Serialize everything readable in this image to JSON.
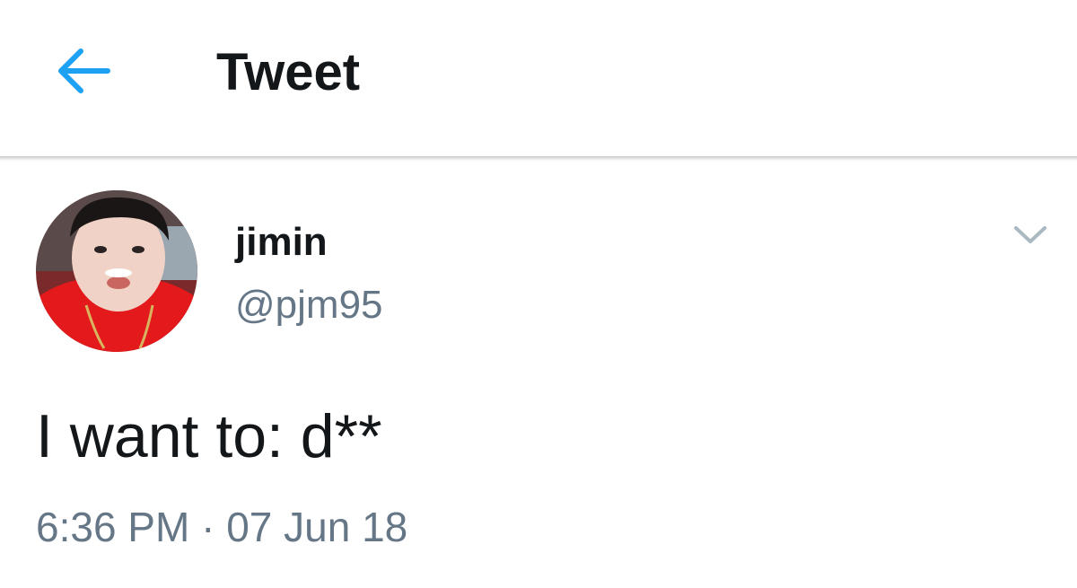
{
  "header": {
    "back_icon": "arrow-left-icon",
    "title": "Tweet"
  },
  "tweet": {
    "author": {
      "display_name": "jimin",
      "handle": "@pjm95",
      "avatar_icon": "user-avatar"
    },
    "menu_icon": "chevron-down-icon",
    "text": "I want to: d**",
    "time": "6:36 PM",
    "separator": "·",
    "date": "07 Jun 18"
  },
  "colors": {
    "accent": "#1da1f2",
    "text_primary": "#14171a",
    "text_secondary": "#657786",
    "chevron": "#aab8c2",
    "avatar_shirt": "#e3191b"
  }
}
